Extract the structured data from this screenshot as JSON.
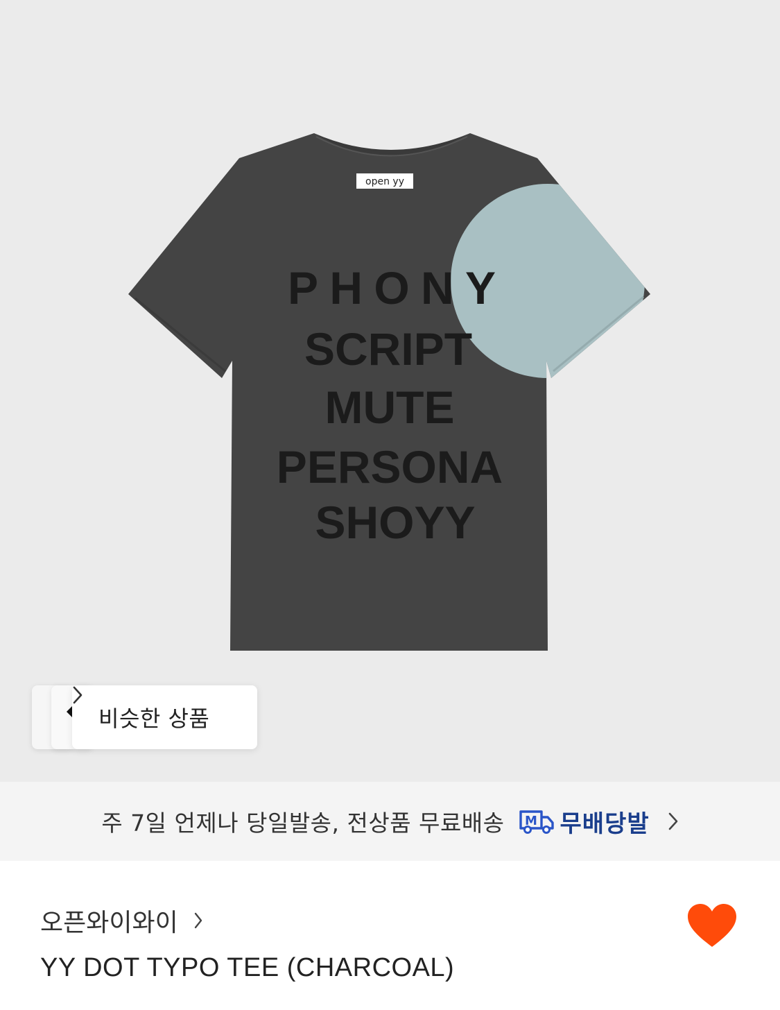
{
  "product_image": {
    "label_tag": "open yy",
    "print_lines": [
      "PHONY",
      "SCRIPT",
      "MUTE",
      "PERSONA",
      "SHOYY"
    ]
  },
  "similar": {
    "label": "비슷한 상품"
  },
  "shipping": {
    "text": "주 7일 언제나 당일발송, 전상품 무료배송",
    "logo_letter": "M",
    "brand": "무배당발"
  },
  "product": {
    "brand": "오픈와이와이",
    "name": "YY DOT TYPO TEE (CHARCOAL)",
    "liked": true
  },
  "colors": {
    "shirt": "#444444",
    "sleeve_accent": "#a9c0c3",
    "print": "#1b1b1b",
    "heart": "#ff4b0a",
    "shipping_brand": "#1a3e8c",
    "background": "#ebebeb"
  },
  "icons": {
    "similar": "chevron-right-icon",
    "shipping_logo": "delivery-truck-icon",
    "shipping_more": "chevron-right-icon",
    "brand_more": "chevron-right-icon",
    "like": "heart-icon"
  }
}
